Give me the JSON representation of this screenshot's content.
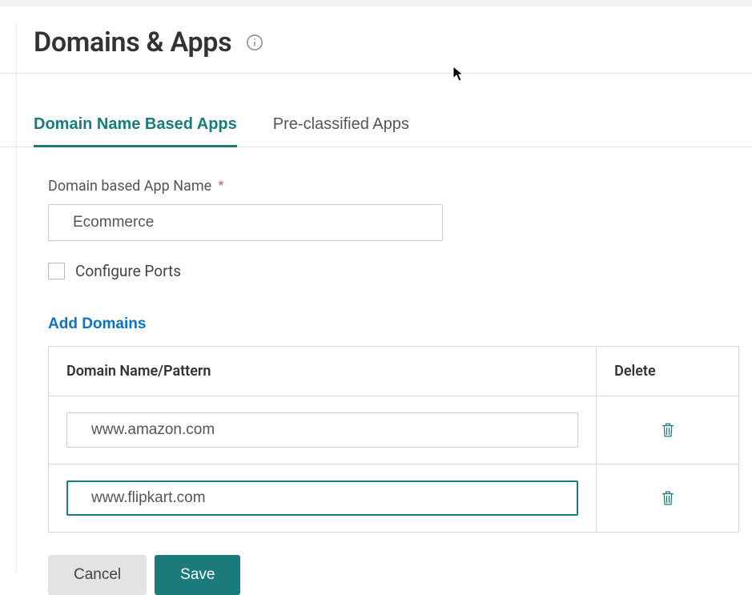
{
  "header": {
    "title": "Domains & Apps"
  },
  "tabs": [
    {
      "label": "Domain Name Based Apps",
      "active": true
    },
    {
      "label": "Pre-classified Apps",
      "active": false
    }
  ],
  "form": {
    "app_name_label": "Domain based App Name",
    "app_name_value": "Ecommerce",
    "configure_ports_label": "Configure Ports",
    "configure_ports_checked": false,
    "add_domains_label": "Add Domains",
    "table": {
      "col_domain": "Domain Name/Pattern",
      "col_delete": "Delete",
      "rows": [
        {
          "value": "www.amazon.com",
          "focused": false
        },
        {
          "value": "www.flipkart.com",
          "focused": true
        }
      ]
    }
  },
  "actions": {
    "cancel": "Cancel",
    "save": "Save"
  },
  "colors": {
    "accent": "#1a7b7a",
    "link": "#0b72c4"
  }
}
